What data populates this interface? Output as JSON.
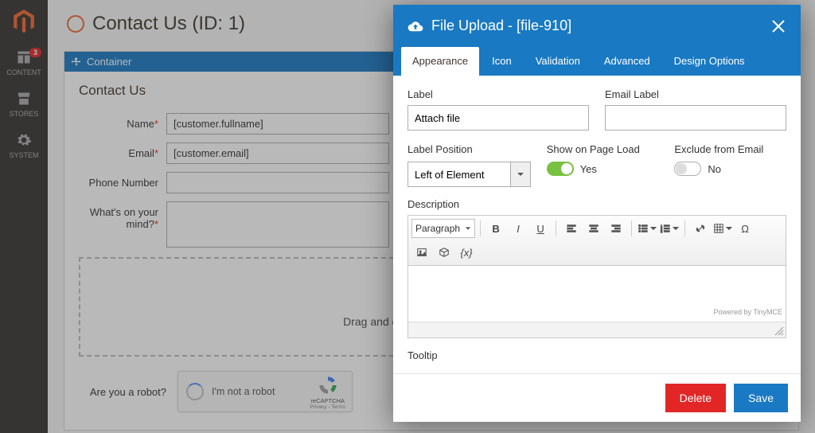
{
  "sidebar": {
    "items": [
      {
        "label": "CONTENT",
        "badge": "3"
      },
      {
        "label": "STORES"
      },
      {
        "label": "SYSTEM"
      }
    ]
  },
  "page": {
    "title": "Contact Us (ID: 1)"
  },
  "container": {
    "label": "Container"
  },
  "form": {
    "heading": "Contact Us",
    "fields": {
      "name": {
        "label": "Name",
        "value": "[customer.fullname]"
      },
      "email": {
        "label": "Email",
        "value": "[customer.email]"
      },
      "phone": {
        "label": "Phone Number",
        "value": ""
      },
      "mind": {
        "label": "What's on your mind?",
        "value": ""
      }
    },
    "dropzone": "Drag and drop files or click to select",
    "captcha": {
      "label": "Are you a robot?",
      "text": "I'm not a robot",
      "brand": "reCAPTCHA",
      "terms": "Privacy - Terms"
    }
  },
  "modal": {
    "title": "File Upload - [file-910]",
    "tabs": [
      "Appearance",
      "Icon",
      "Validation",
      "Advanced",
      "Design Options"
    ],
    "fields": {
      "label": {
        "label": "Label",
        "value": "Attach file"
      },
      "emailLabel": {
        "label": "Email Label",
        "value": ""
      },
      "labelPosition": {
        "label": "Label Position",
        "value": "Left of Element"
      },
      "showOnLoad": {
        "label": "Show on Page Load",
        "value": "Yes"
      },
      "excludeEmail": {
        "label": "Exclude from Email",
        "value": "No"
      },
      "description": {
        "label": "Description"
      },
      "tooltip": {
        "label": "Tooltip"
      }
    },
    "editor": {
      "format": "Paragraph",
      "powered": "Powered by TinyMCE"
    },
    "buttons": {
      "delete": "Delete",
      "save": "Save"
    }
  }
}
